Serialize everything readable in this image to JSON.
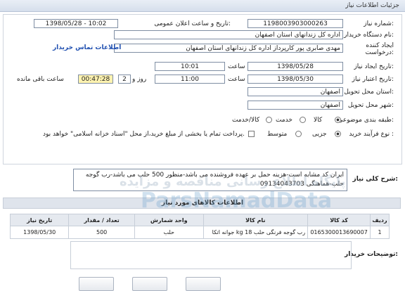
{
  "page_title": "جزئیات اطلاعات نیاز",
  "fields": {
    "need_number_label": "شماره نیاز:",
    "need_number": "1198003903000263",
    "announce_label": "تاریخ و ساعت اعلان عمومی:",
    "announce_value": "1398/05/28 - 10:02",
    "buyer_org_label": "نام دستگاه خریدار:",
    "buyer_org": "اداره کل زندانهای استان اصفهان",
    "requester_label": "ایجاد کننده درخواست:",
    "requester": "مهدی صابری پور کارپرداز اداره کل زندانهای استان اصفهان",
    "buyer_contact_link": "اطلاعات تماس خریدار",
    "create_date_label": "تاریخ ایجاد نیاز:",
    "create_date": "1398/05/28",
    "time_label": "ساعت",
    "create_time": "10:01",
    "deadline_label": "تاریخ اعتبار نیاز:",
    "deadline_date": "1398/05/30",
    "deadline_time": "11:00",
    "day_and_label": "روز و",
    "days": "2",
    "remaining": "00:47:28",
    "remaining_label": "ساعت باقی مانده",
    "province_label": "استان محل تحویل:",
    "province": "اصفهان",
    "city_label": "شهر محل تحویل:",
    "city": "اصفهان",
    "category_label": "طبقه بندی موضوعی:",
    "category_options": [
      "کالا",
      "خدمت",
      "کالا/خدمت"
    ],
    "category_selected": 0,
    "purchase_type_label": "نوع فرآیند خرید :",
    "purchase_options": [
      "جزیی",
      "متوسط"
    ],
    "purchase_selected": 0,
    "payment_note": "پرداخت تمام یا بخشی از مبلغ خرید،از محل \"اسناد خزانه اسلامی\" خواهد بود."
  },
  "description": {
    "label": "شرح کلی نیاز:",
    "text": "ایران کد مشابه است-هزینه حمل بر عهده فروشنده می باشد-منظور 500 حلب می باشد-رب گوجه حلب-هماهنگی 09134043703"
  },
  "goods": {
    "section_label": "اطلاعات کالاهای مورد نیاز",
    "columns": [
      "ردیف",
      "کد کالا",
      "نام کالا",
      "واحد شمارش",
      "تعداد / مقدار",
      "تاریخ نیاز"
    ],
    "rows": [
      [
        "1",
        "0165300013690007",
        "رب گوجه فرنگی حلب 18 kg جوانه اتکا",
        "حلب",
        "500",
        "1398/05/30"
      ]
    ]
  },
  "buyer_notes_label": "توضیحات خریدار:",
  "watermark": {
    "line1": "پایگاه اطلاع رسانی مناقصه و مزایده",
    "brand": "ParsNamadData"
  }
}
